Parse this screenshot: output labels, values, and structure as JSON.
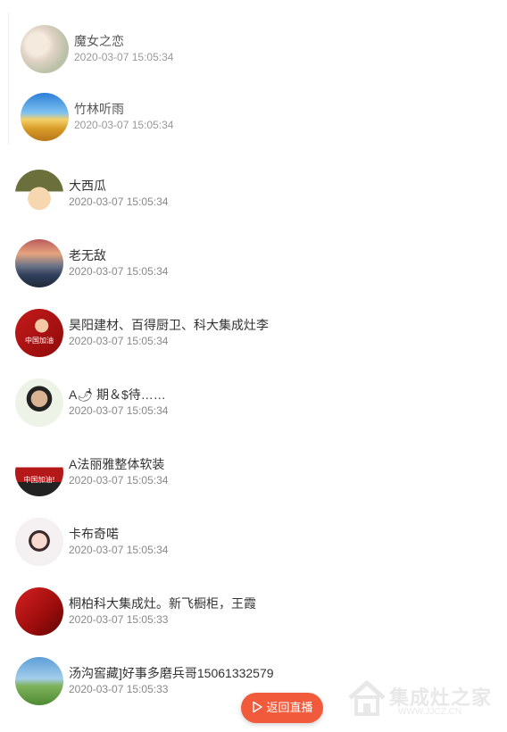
{
  "messages": [
    {
      "name": "魔女之恋",
      "time": "2020-03-07 15:05:34"
    },
    {
      "name": "竹林听雨",
      "time": "2020-03-07 15:05:34"
    },
    {
      "name": "大西瓜",
      "time": "2020-03-07 15:05:34"
    },
    {
      "name": "老无敌",
      "time": "2020-03-07 15:05:34"
    },
    {
      "name": "昊阳建材、百得厨卫、科大集成灶李",
      "time": "2020-03-07 15:05:34",
      "avatar_text": "中国加油"
    },
    {
      "name": "A🌶 期＆$待……",
      "time": "2020-03-07 15:05:34"
    },
    {
      "name": "A法丽雅整体软装",
      "time": "2020-03-07 15:05:34",
      "avatar_text": "中国加油!"
    },
    {
      "name": "卡布奇喏",
      "time": "2020-03-07 15:05:34"
    },
    {
      "name": "桐柏科大集成灶。新飞橱柜，王霞",
      "time": "2020-03-07 15:05:33"
    },
    {
      "name": "汤沟窖藏]好事多磨兵哥15061332579",
      "time": "2020-03-07 15:05:33"
    }
  ],
  "back_live_button": {
    "label": "返回直播",
    "icon": "play-icon",
    "color": "#f15a3b"
  },
  "watermark": {
    "text": "集成灶之家",
    "url": "WWW.JJCZ.CN",
    "icon": "house-logo-icon"
  }
}
